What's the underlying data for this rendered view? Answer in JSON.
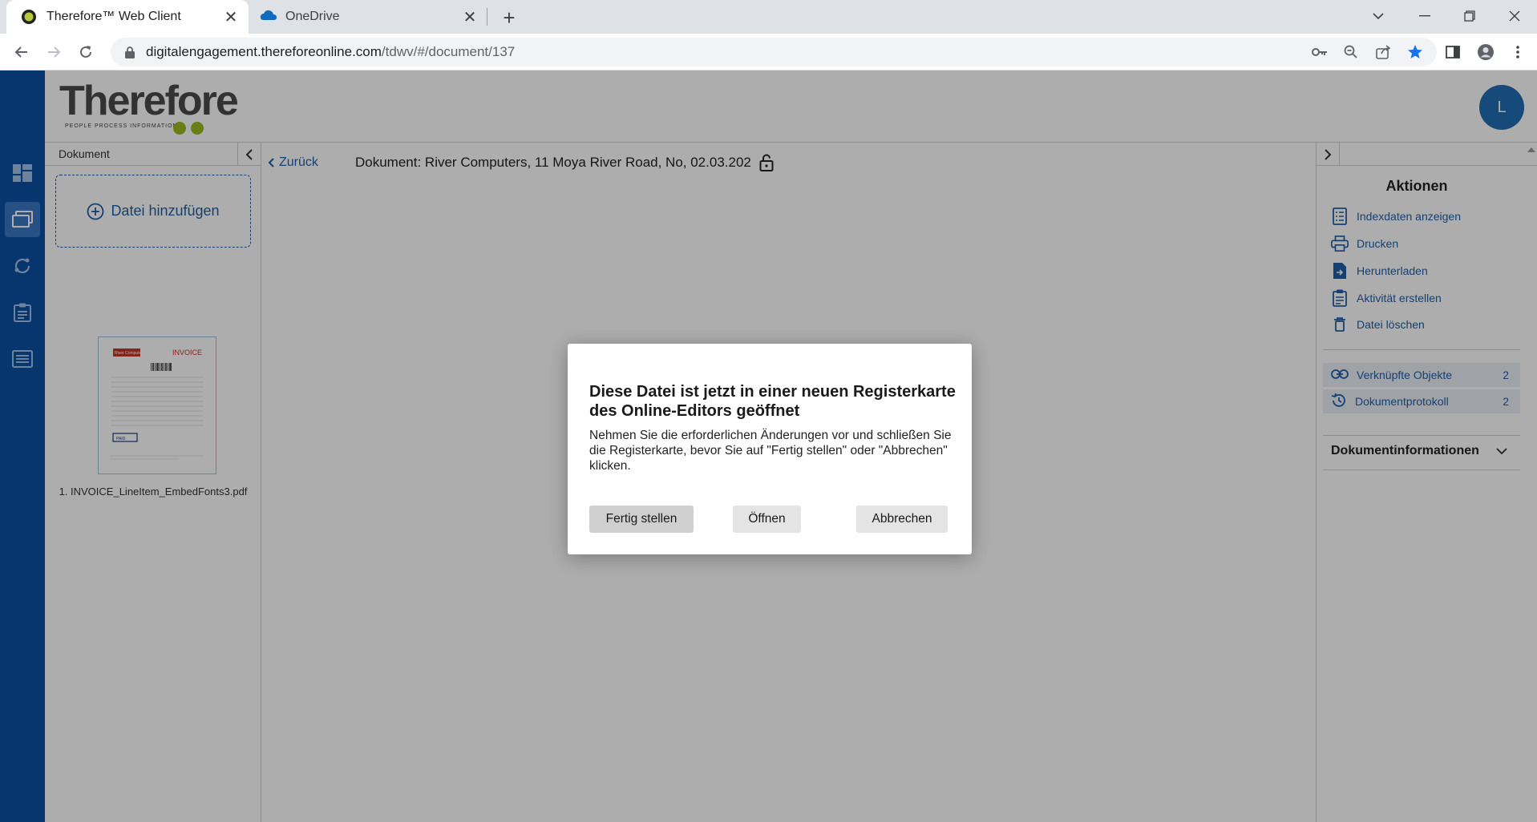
{
  "browser": {
    "tabs": [
      {
        "title": "Therefore™ Web Client",
        "active": true
      },
      {
        "title": "OneDrive",
        "active": false
      }
    ],
    "url_host": "digitalengagement.thereforeonline.com",
    "url_path": "/tdwv/#/document/137"
  },
  "app": {
    "logo_text": "Therefore",
    "logo_tagline": "PEOPLE  PROCESS  INFORMATION",
    "avatar_initial": "L",
    "accent_color": "#0b4ea2"
  },
  "doc_panel": {
    "header": "Dokument",
    "add_file_label": "Datei hinzufügen",
    "files": [
      {
        "name": "1. INVOICE_LineItem_EmbedFonts3.pdf"
      }
    ],
    "thumbnail": {
      "company": "River Computers",
      "heading": "INVOICE",
      "stamp": "PAID"
    }
  },
  "main": {
    "back_label": "Zurück",
    "document_title": "Dokument: River Computers, 11 Moya River Road, No, 02.03.202"
  },
  "actions_panel": {
    "title": "Aktionen",
    "actions": [
      {
        "label": "Indexdaten anzeigen",
        "icon": "index-data-icon"
      },
      {
        "label": "Drucken",
        "icon": "print-icon"
      },
      {
        "label": "Herunterladen",
        "icon": "download-icon"
      },
      {
        "label": "Aktivität erstellen",
        "icon": "clipboard-icon"
      },
      {
        "label": "Datei löschen",
        "icon": "trash-icon"
      }
    ],
    "links": [
      {
        "label": "Verknüpfte Objekte",
        "count": "2",
        "icon": "link-icon"
      },
      {
        "label": "Dokumentprotokoll",
        "count": "2",
        "icon": "history-icon"
      }
    ],
    "doc_info_label": "Dokumentinformationen"
  },
  "dialog": {
    "title": "Diese Datei ist jetzt in einer neuen Registerkarte des Online-Editors geöffnet",
    "body": "Nehmen Sie die erforderlichen Änderungen vor und schließen Sie die Registerkarte, bevor Sie auf \"Fertig stellen\" oder \"Abbrechen\" klicken.",
    "buttons": {
      "finish": "Fertig stellen",
      "open": "Öffnen",
      "cancel": "Abbrechen"
    }
  }
}
